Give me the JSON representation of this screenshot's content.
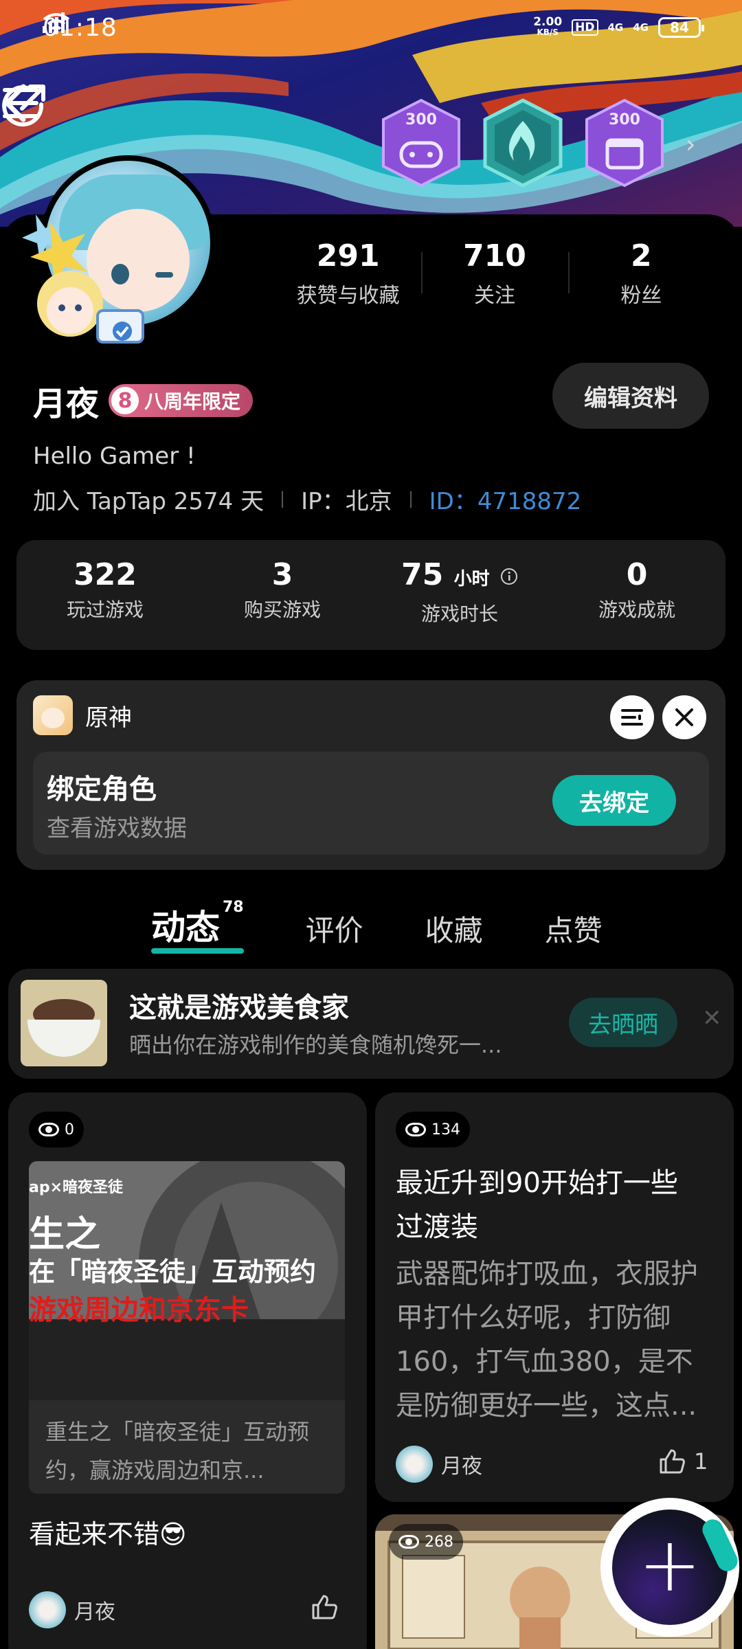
{
  "status": {
    "time": "01:18",
    "speed_value": "2.00",
    "speed_unit": "KB/S",
    "hd": "HD",
    "net1": "4G",
    "net2": "4G",
    "battery": "84"
  },
  "badges": [
    {
      "value": "300"
    },
    {
      "value": ""
    },
    {
      "value": "300"
    }
  ],
  "profile": {
    "stats": [
      {
        "value": "291",
        "label": "获赞与收藏"
      },
      {
        "value": "710",
        "label": "关注"
      },
      {
        "value": "2",
        "label": "粉丝"
      }
    ],
    "name": "月夜",
    "tag_number": "8",
    "tag_label": "八周年限定",
    "edit_label": "编辑资料",
    "bio": "Hello Gamer !",
    "joined": "加入 TapTap 2574 天",
    "ip": "IP：北京",
    "id": "ID：4718872"
  },
  "game_stats": [
    {
      "value": "322",
      "unit": "",
      "label": "玩过游戏"
    },
    {
      "value": "3",
      "unit": "",
      "label": "购买游戏"
    },
    {
      "value": "75",
      "unit": "小时",
      "label": "游戏时长"
    },
    {
      "value": "0",
      "unit": "",
      "label": "游戏成就"
    }
  ],
  "bind": {
    "game": "原神",
    "title": "绑定角色",
    "subtitle": "查看游戏数据",
    "button": "去绑定"
  },
  "tabs": [
    {
      "label": "动态",
      "count": "78",
      "active": true
    },
    {
      "label": "评价"
    },
    {
      "label": "收藏"
    },
    {
      "label": "点赞"
    }
  ],
  "promo": {
    "title": "这就是游戏美食家",
    "subtitle": "晒出你在游戏制作的美食随机馋死一...",
    "button": "去晒晒",
    "close": "✕"
  },
  "posts": [
    {
      "views": "0",
      "image_lines": [
        "ap×暗夜圣徒",
        "生之",
        "在「暗夜圣徒」互动预约",
        "游戏周边和京东卡"
      ],
      "caption": "重生之「暗夜圣徒」互动预约，赢游戏周边和京...",
      "text": "看起来不错😎",
      "author": "月夜",
      "likes": ""
    },
    {
      "views": "134",
      "title": "最近升到90开始打一些过渡装",
      "body": "武器配饰打吸血，衣服护甲打什么好呢，打防御160，打气血380，是不是防御更好一些，这点...",
      "author": "月夜",
      "likes": "1"
    },
    {
      "views": "268"
    }
  ]
}
